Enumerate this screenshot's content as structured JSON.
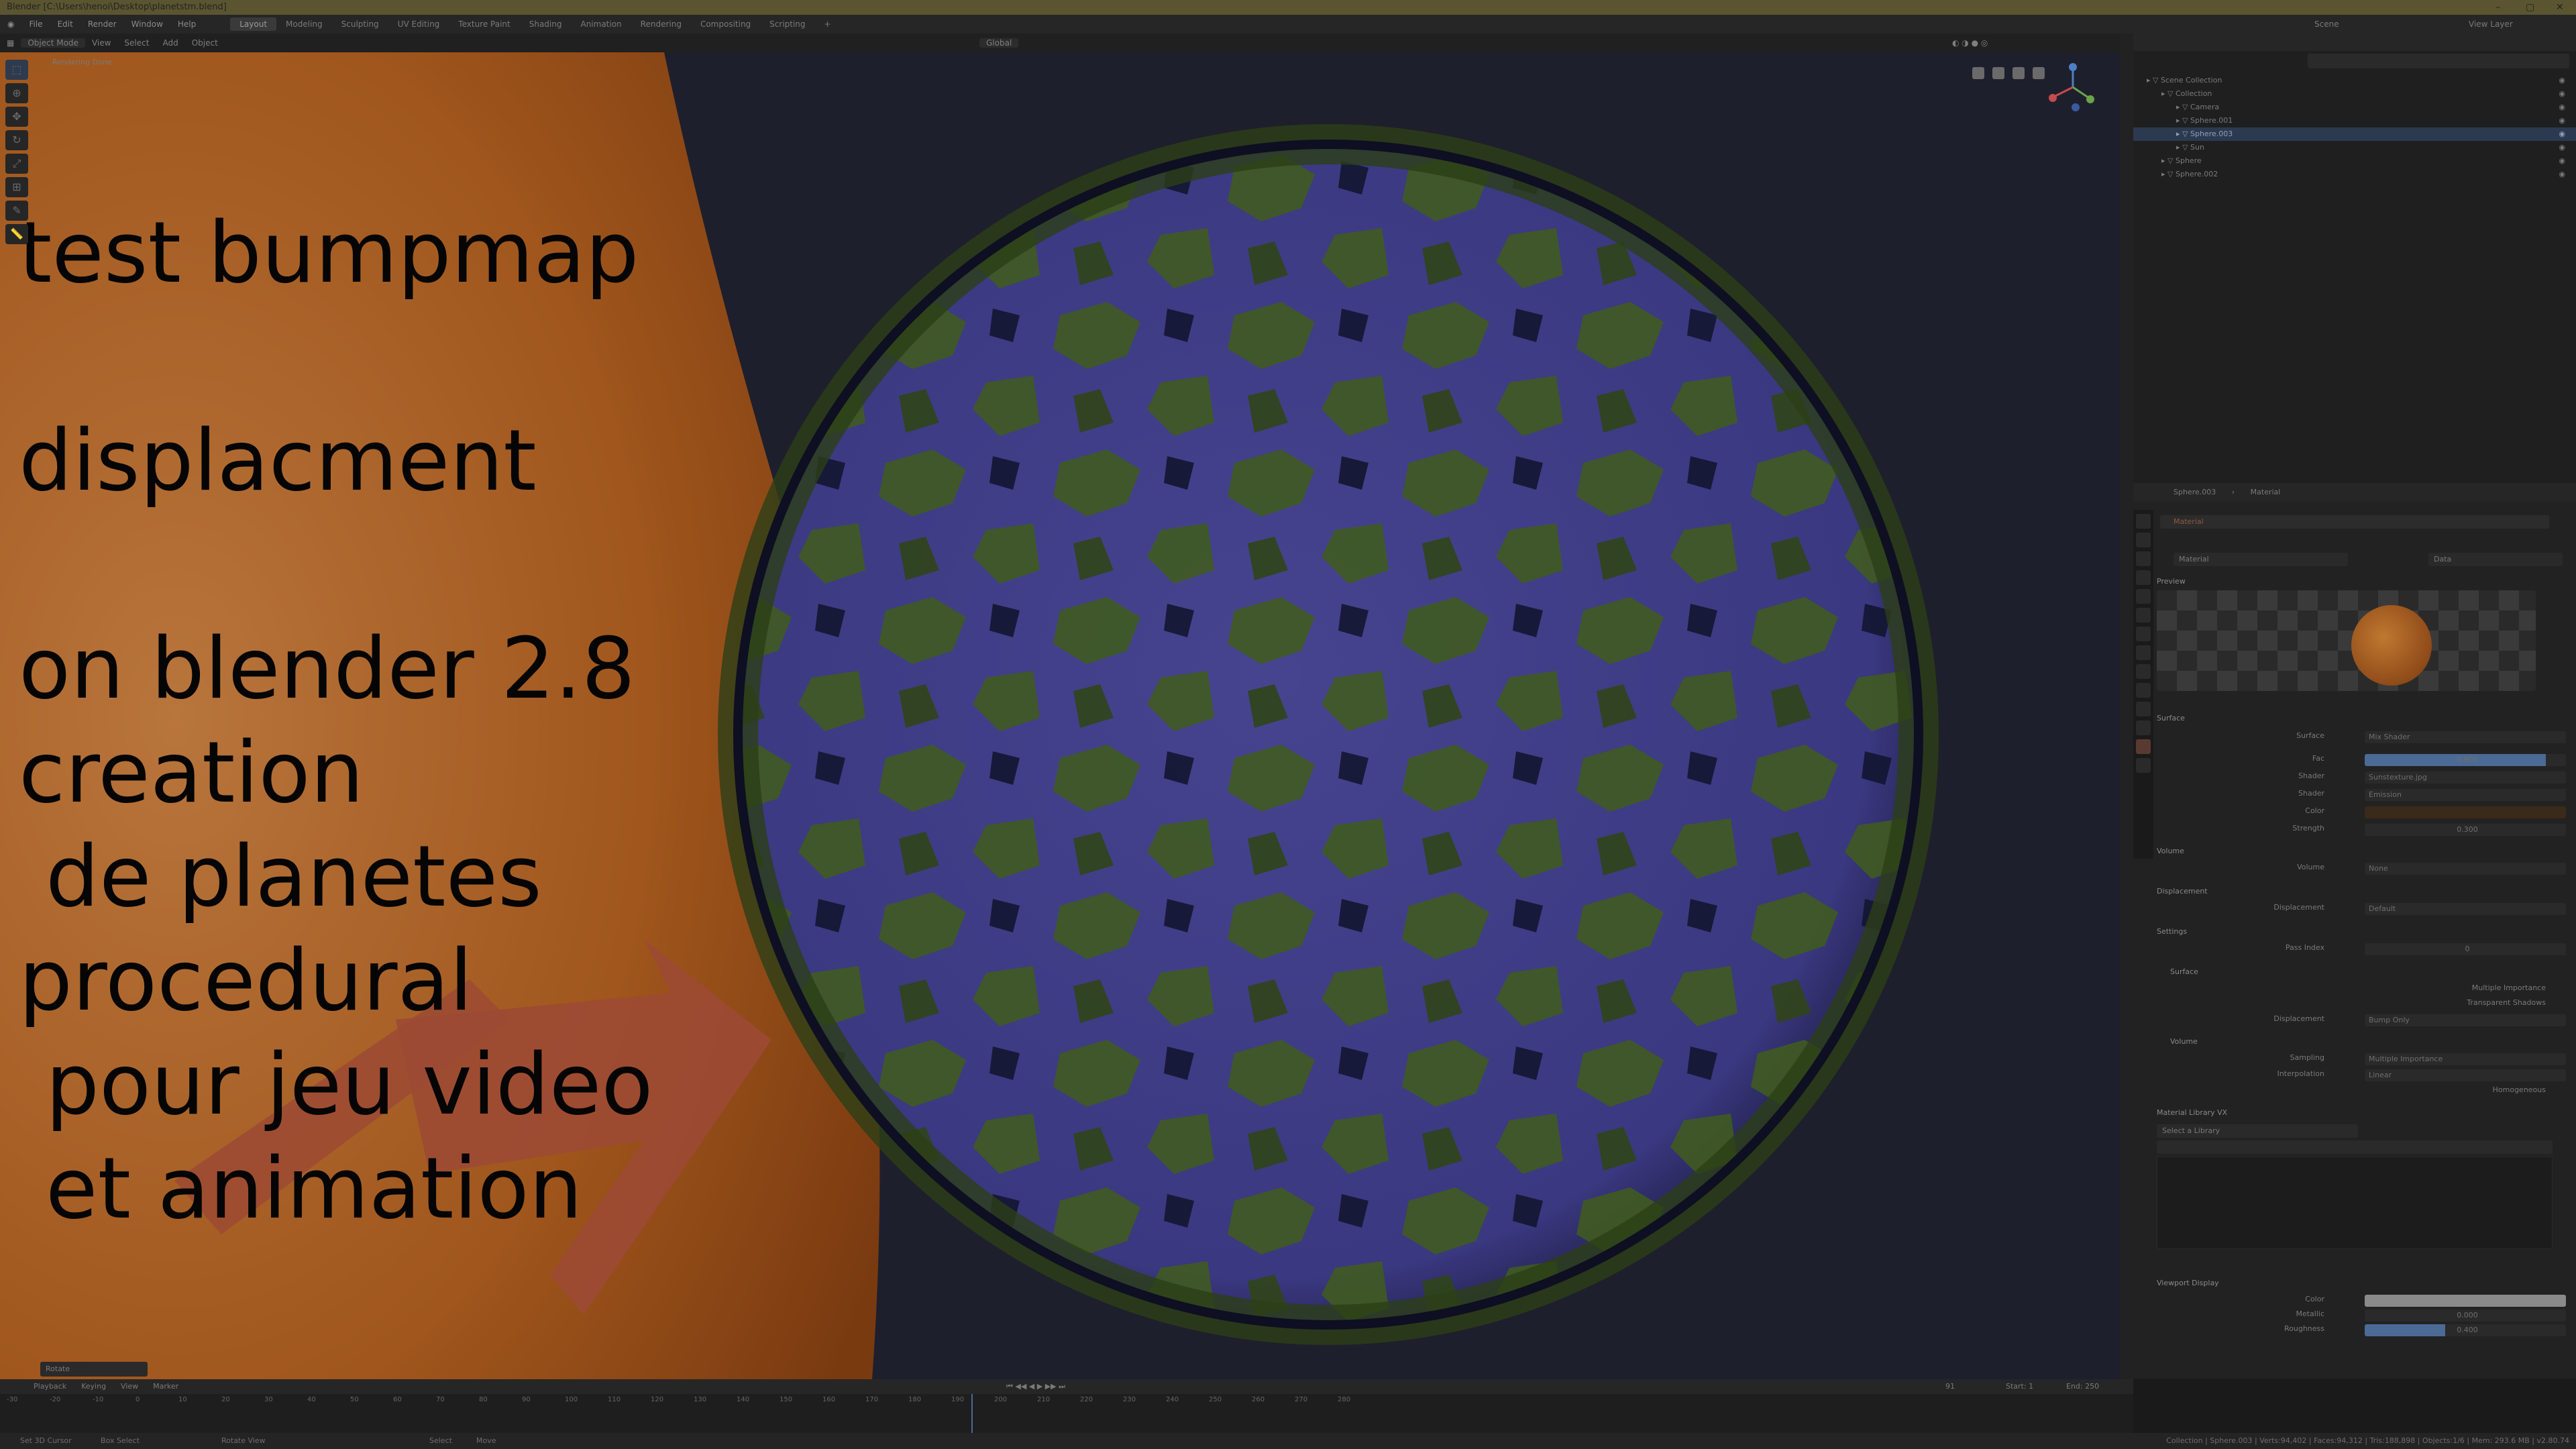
{
  "window": {
    "title": "Blender [C:\\Users\\henoi\\Desktop\\planetstm.blend]"
  },
  "menu": [
    "File",
    "Edit",
    "Render",
    "Window",
    "Help"
  ],
  "workspaces": [
    "Layout",
    "Modeling",
    "Sculpting",
    "UV Editing",
    "Texture Paint",
    "Shading",
    "Animation",
    "Rendering",
    "Compositing",
    "Scripting"
  ],
  "active_workspace": "Layout",
  "scene": {
    "label": "Scene",
    "view_layer": "View Layer"
  },
  "viewport_header": {
    "mode": "Object Mode",
    "items": [
      "View",
      "Select",
      "Add",
      "Object"
    ],
    "orientation": "Global"
  },
  "viewport": {
    "status": "Rendering Done",
    "overlay_lines": [
      "test bumpmap",
      "",
      "displacment",
      "",
      "on blender 2.8",
      "creation",
      " de planetes",
      "procedural",
      " pour jeu video",
      " et animation"
    ]
  },
  "operator_panel": "Rotate",
  "outliner": {
    "items": [
      {
        "name": "Scene Collection",
        "depth": 0,
        "selected": false
      },
      {
        "name": "Collection",
        "depth": 1,
        "selected": false
      },
      {
        "name": "Camera",
        "depth": 2,
        "selected": false
      },
      {
        "name": "Sphere.001",
        "depth": 2,
        "selected": false
      },
      {
        "name": "Sphere.003",
        "depth": 2,
        "selected": true
      },
      {
        "name": "Sun",
        "depth": 2,
        "selected": false
      },
      {
        "name": "Sphere",
        "depth": 1,
        "selected": false
      },
      {
        "name": "Sphere.002",
        "depth": 1,
        "selected": false
      }
    ]
  },
  "properties": {
    "breadcrumb": [
      "Sphere.003",
      "Material"
    ],
    "slot": "Material",
    "material_name": "Material",
    "link": "Data",
    "sections": {
      "preview": "Preview",
      "surface": "Surface",
      "volume": "Volume",
      "displacement": "Displacement",
      "settings": "Settings",
      "settings_surface": "Surface",
      "settings_volume": "Volume",
      "library": "Material Library VX",
      "viewport_display": "Viewport Display"
    },
    "rows": {
      "surface": {
        "label": "Surface",
        "value": "Mix Shader"
      },
      "fac": {
        "label": "Fac",
        "value": "0.900"
      },
      "shader1": {
        "label": "Shader",
        "value": "Sunstexture.jpg"
      },
      "shader2": {
        "label": "Shader",
        "value": "Emission"
      },
      "color": {
        "label": "Color",
        "value": ""
      },
      "strength": {
        "label": "Strength",
        "value": "0.300"
      },
      "volume": {
        "label": "Volume",
        "value": "None"
      },
      "displacement": {
        "label": "Displacement",
        "value": "Default"
      },
      "pass_index": {
        "label": "Pass Index",
        "value": "0"
      },
      "multiple_importance": "Multiple Importance",
      "transparent_shadows": "Transparent Shadows",
      "disp_method": {
        "label": "Displacement",
        "value": "Bump Only"
      },
      "sampling": {
        "label": "Sampling",
        "value": "Multiple Importance"
      },
      "interpolation": {
        "label": "Interpolation",
        "value": "Linear"
      },
      "homogeneous": "Homogeneous",
      "library_select": "Select a Library",
      "vd_color": {
        "label": "Color",
        "value": ""
      },
      "metallic": {
        "label": "Metallic",
        "value": "0.000"
      },
      "roughness": {
        "label": "Roughness",
        "value": "0.400"
      }
    }
  },
  "timeline": {
    "items": [
      "Playback",
      "Keying",
      "View",
      "Marker"
    ],
    "frame": "91",
    "start": "Start: 1",
    "end": "End: 250",
    "ticks": [
      "-30",
      "-20",
      "-10",
      "0",
      "10",
      "20",
      "30",
      "40",
      "50",
      "60",
      "70",
      "80",
      "90",
      "100",
      "110",
      "120",
      "130",
      "140",
      "150",
      "160",
      "170",
      "180",
      "190",
      "200",
      "210",
      "220",
      "230",
      "240",
      "250",
      "260",
      "270",
      "280"
    ]
  },
  "status": {
    "left": [
      "Set 3D Cursor",
      "Box Select",
      "Rotate View",
      "Select",
      "Move"
    ],
    "right": "Collection | Sphere.003 | Verts:94,402 | Faces:94,312 | Tris:188,898 | Objects:1/6 | Mem: 293.6 MB | v2.80.74"
  },
  "colors": {
    "sphere_ocean": "#3c3a86",
    "sphere_land": "#3f5a20",
    "sun": "#a0561c",
    "arrow": "#9c4a34",
    "viewport_bg": "#1e1f2c"
  }
}
